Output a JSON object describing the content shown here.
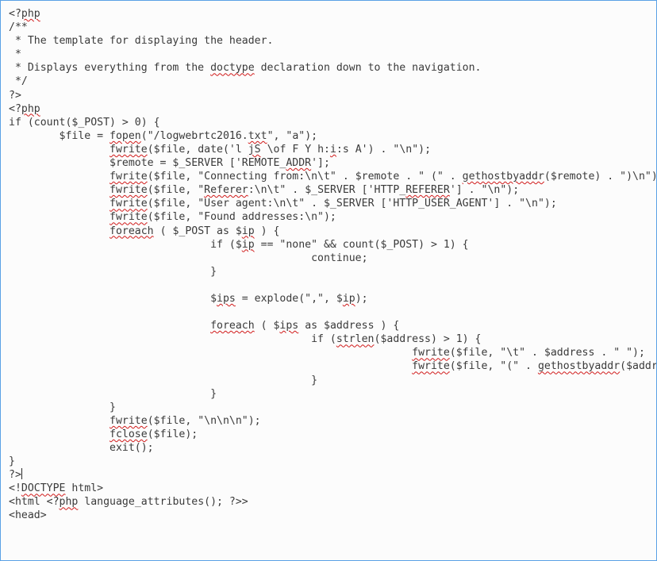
{
  "code": {
    "lines": [
      {
        "indent": 0,
        "segments": [
          {
            "t": "<?",
            "sq": false
          },
          {
            "t": "php",
            "sq": true
          }
        ]
      },
      {
        "indent": 0,
        "segments": [
          {
            "t": "/**",
            "sq": false
          }
        ]
      },
      {
        "indent": 0,
        "segments": [
          {
            "t": " * The template for displaying the header.",
            "sq": false
          }
        ]
      },
      {
        "indent": 0,
        "segments": [
          {
            "t": " *",
            "sq": false
          }
        ]
      },
      {
        "indent": 0,
        "segments": [
          {
            "t": " * Displays everything from the ",
            "sq": false
          },
          {
            "t": "doctype",
            "sq": true
          },
          {
            "t": " declaration down to the navigation.",
            "sq": false
          }
        ]
      },
      {
        "indent": 0,
        "segments": [
          {
            "t": " */",
            "sq": false
          }
        ]
      },
      {
        "indent": 0,
        "segments": [
          {
            "t": "?>",
            "sq": false
          }
        ]
      },
      {
        "indent": 0,
        "segments": [
          {
            "t": "<?",
            "sq": false
          },
          {
            "t": "php",
            "sq": true
          }
        ]
      },
      {
        "indent": 0,
        "segments": [
          {
            "t": "if (count($_POST) > 0) {",
            "sq": false
          }
        ]
      },
      {
        "indent": 1,
        "segments": [
          {
            "t": "$file = ",
            "sq": false
          },
          {
            "t": "fopen",
            "sq": true
          },
          {
            "t": "(\"/logwebrtc2016.",
            "sq": false
          },
          {
            "t": "txt",
            "sq": true
          },
          {
            "t": "\", \"a\");",
            "sq": false
          }
        ]
      },
      {
        "indent": 2,
        "segments": [
          {
            "t": "fwrite",
            "sq": true
          },
          {
            "t": "($file, date('l ",
            "sq": false
          },
          {
            "t": "jS",
            "sq": true
          },
          {
            "t": " \\of F Y h:",
            "sq": false
          },
          {
            "t": "i",
            "sq": true
          },
          {
            "t": ":s A') . \"\\n\");",
            "sq": false
          }
        ]
      },
      {
        "indent": 2,
        "segments": [
          {
            "t": "$remote = $_SERVER ['REMOTE_",
            "sq": false
          },
          {
            "t": "ADDR",
            "sq": true
          },
          {
            "t": "'];",
            "sq": false
          }
        ]
      },
      {
        "indent": 2,
        "segments": [
          {
            "t": "fwrite",
            "sq": true
          },
          {
            "t": "($file, \"Connecting from:\\n\\t\" . $remote . \" (\" . ",
            "sq": false
          },
          {
            "t": "gethostbyaddr",
            "sq": true
          },
          {
            "t": "($remote) . \")\\n\");",
            "sq": false
          }
        ]
      },
      {
        "indent": 2,
        "segments": [
          {
            "t": "fwrite",
            "sq": true
          },
          {
            "t": "($file, \"",
            "sq": false
          },
          {
            "t": "Referer",
            "sq": true
          },
          {
            "t": ":\\n\\t\" . $_SERVER ['HTTP_",
            "sq": false
          },
          {
            "t": "REFERER",
            "sq": true
          },
          {
            "t": "'] . \"\\n\");",
            "sq": false
          }
        ]
      },
      {
        "indent": 2,
        "segments": [
          {
            "t": "fwrite",
            "sq": true
          },
          {
            "t": "($file, \"User agent:\\n\\t\" . $_SERVER ['HTTP_USER_AGENT'] . \"\\n\");",
            "sq": false
          }
        ]
      },
      {
        "indent": 2,
        "segments": [
          {
            "t": "fwrite",
            "sq": true
          },
          {
            "t": "($file, \"Found addresses:\\n\");",
            "sq": false
          }
        ]
      },
      {
        "indent": 2,
        "segments": [
          {
            "t": "foreach",
            "sq": true
          },
          {
            "t": " ( $_POST as $",
            "sq": false
          },
          {
            "t": "ip",
            "sq": true
          },
          {
            "t": " ) {",
            "sq": false
          }
        ]
      },
      {
        "indent": 4,
        "segments": [
          {
            "t": "if ($",
            "sq": false
          },
          {
            "t": "ip",
            "sq": true
          },
          {
            "t": " == \"none\" && count($_POST) > 1) {",
            "sq": false
          }
        ]
      },
      {
        "indent": 6,
        "segments": [
          {
            "t": "continue;",
            "sq": false
          }
        ]
      },
      {
        "indent": 4,
        "segments": [
          {
            "t": "}",
            "sq": false
          }
        ]
      },
      {
        "indent": 0,
        "segments": [
          {
            "t": "",
            "sq": false
          }
        ]
      },
      {
        "indent": 4,
        "segments": [
          {
            "t": "$",
            "sq": false
          },
          {
            "t": "ips",
            "sq": true
          },
          {
            "t": " = explode(\",\", $",
            "sq": false
          },
          {
            "t": "ip",
            "sq": true
          },
          {
            "t": ");",
            "sq": false
          }
        ]
      },
      {
        "indent": 0,
        "segments": [
          {
            "t": "",
            "sq": false
          }
        ]
      },
      {
        "indent": 4,
        "segments": [
          {
            "t": "foreach",
            "sq": true
          },
          {
            "t": " ( $",
            "sq": false
          },
          {
            "t": "ips",
            "sq": true
          },
          {
            "t": " as $address ) {",
            "sq": false
          }
        ]
      },
      {
        "indent": 6,
        "segments": [
          {
            "t": "if (",
            "sq": false
          },
          {
            "t": "strlen",
            "sq": true
          },
          {
            "t": "($address) > 1) {",
            "sq": false
          }
        ]
      },
      {
        "indent": 8,
        "segments": [
          {
            "t": "fwrite",
            "sq": true
          },
          {
            "t": "($file, \"\\t\" . $address . \" \");",
            "sq": false
          }
        ]
      },
      {
        "indent": 8,
        "segments": [
          {
            "t": "fwrite",
            "sq": true
          },
          {
            "t": "($file, \"(\" . ",
            "sq": false
          },
          {
            "t": "gethostbyaddr",
            "sq": true
          },
          {
            "t": "($address) . \")\\n\");",
            "sq": false
          }
        ]
      },
      {
        "indent": 6,
        "segments": [
          {
            "t": "}",
            "sq": false
          }
        ]
      },
      {
        "indent": 4,
        "segments": [
          {
            "t": "}",
            "sq": false
          }
        ]
      },
      {
        "indent": 2,
        "segments": [
          {
            "t": "}",
            "sq": false
          }
        ]
      },
      {
        "indent": 2,
        "segments": [
          {
            "t": "fwrite",
            "sq": true
          },
          {
            "t": "($file, \"\\n\\n\\n\");",
            "sq": false
          }
        ]
      },
      {
        "indent": 2,
        "segments": [
          {
            "t": "fclose",
            "sq": true
          },
          {
            "t": "($file);",
            "sq": false
          }
        ]
      },
      {
        "indent": 2,
        "segments": [
          {
            "t": "exit();",
            "sq": false
          }
        ]
      },
      {
        "indent": 0,
        "segments": [
          {
            "t": "}",
            "sq": false
          }
        ]
      },
      {
        "indent": 0,
        "segments": [
          {
            "t": "?>",
            "sq": false
          }
        ],
        "cursor_after": true
      },
      {
        "indent": 0,
        "segments": [
          {
            "t": "<!",
            "sq": false
          },
          {
            "t": "DOCTYPE",
            "sq": true
          },
          {
            "t": " html>",
            "sq": false
          }
        ]
      },
      {
        "indent": 0,
        "segments": [
          {
            "t": "<html <?",
            "sq": false
          },
          {
            "t": "php",
            "sq": true
          },
          {
            "t": " language_attributes(); ?>>",
            "sq": false
          }
        ]
      },
      {
        "indent": 0,
        "segments": [
          {
            "t": "<head>",
            "sq": false
          }
        ]
      }
    ],
    "indent_unit": "        "
  }
}
